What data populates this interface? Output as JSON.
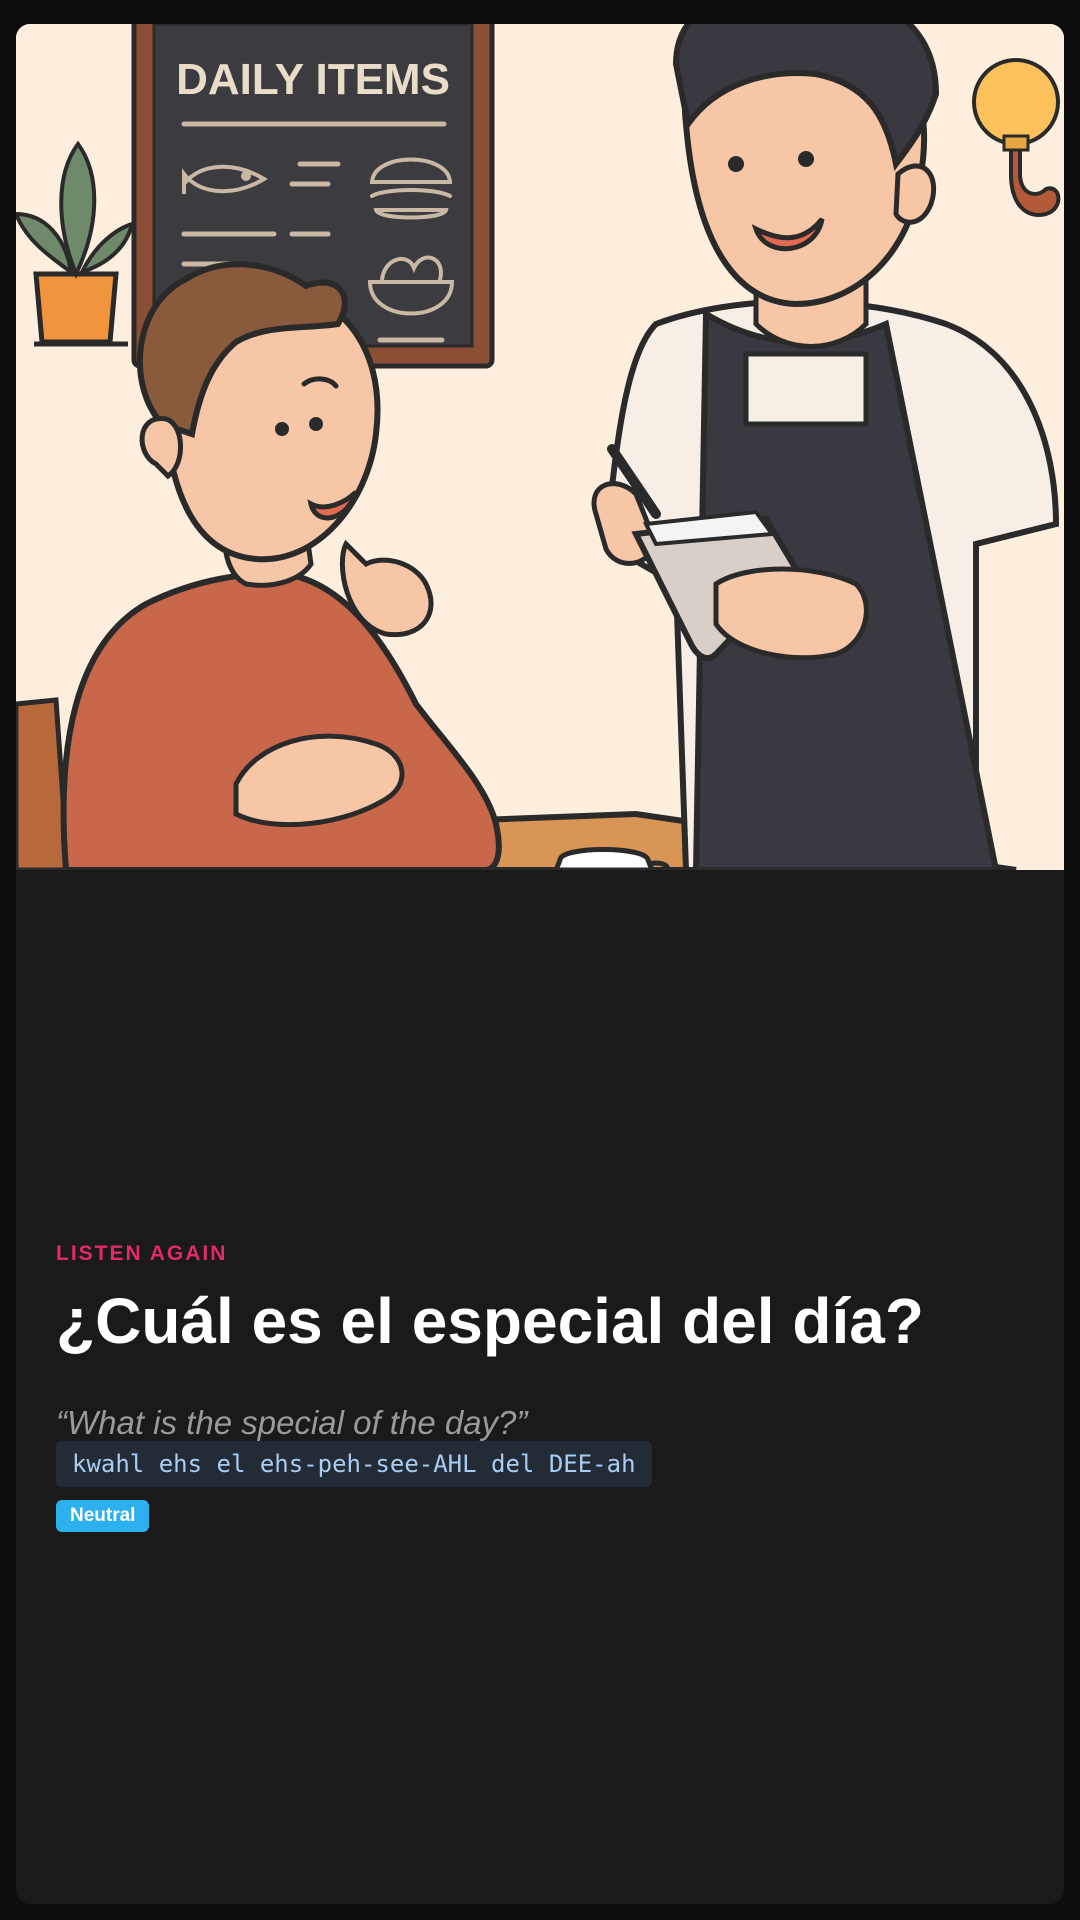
{
  "illustration": {
    "menu_board_title": "DAILY ITEMS"
  },
  "lesson": {
    "eyebrow": "LISTEN AGAIN",
    "phrase": "¿Cuál es el especial del día?",
    "translation": "“What is the special of the day?”",
    "pronunciation": "kwahl ehs el ehs-peh-see-AHL del DEE-ah",
    "register_badge": "Neutral"
  },
  "colors": {
    "accent_eyebrow": "#e3286b",
    "badge": "#2db0ef",
    "card_bg": "#1a1a1a"
  }
}
